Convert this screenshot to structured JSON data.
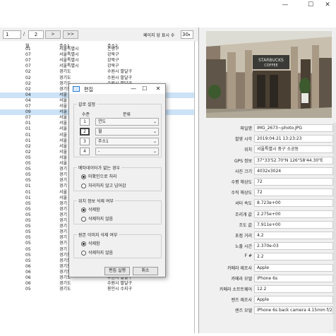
{
  "window": {
    "minimize_glyph": "—",
    "maximize_glyph": "☐",
    "close_glyph": "✕"
  },
  "toolbar": {
    "page_current": "1",
    "page_separator": "/",
    "page_total": "2",
    "next_label": ">",
    "last_label": ">>",
    "per_page_label": "페이지 당 표시 수",
    "per_page_value": "30"
  },
  "grid": {
    "headers": [
      "월",
      "주소1",
      "주소2"
    ],
    "rows": [
      {
        "month": "01",
        "addr1": "서울특별시",
        "addr2": "은평구",
        "selected": false
      },
      {
        "month": "07",
        "addr1": "서울특별시",
        "addr2": "강북구",
        "selected": false
      },
      {
        "month": "07",
        "addr1": "서울특별시",
        "addr2": "강북구",
        "selected": false
      },
      {
        "month": "07",
        "addr1": "서울특별시",
        "addr2": "강북구",
        "selected": false
      },
      {
        "month": "02",
        "addr1": "경기도",
        "addr2": "수원시 팔달구",
        "selected": false
      },
      {
        "month": "02",
        "addr1": "경기도",
        "addr2": "수원시 팔달구",
        "selected": false
      },
      {
        "month": "02",
        "addr1": "경기도",
        "addr2": "수원시 팔달구",
        "selected": false
      },
      {
        "month": "02",
        "addr1": "경기도",
        "addr2": "",
        "selected": false
      },
      {
        "month": "04",
        "addr1": "서울",
        "addr2": "",
        "selected": true
      },
      {
        "month": "04",
        "addr1": "서울",
        "addr2": "",
        "selected": false
      },
      {
        "month": "07",
        "addr1": "서울",
        "addr2": "",
        "selected": false
      },
      {
        "month": "09",
        "addr1": "서울",
        "addr2": "",
        "selected": true
      },
      {
        "month": "07",
        "addr1": "서울",
        "addr2": "",
        "selected": false
      },
      {
        "month": "01",
        "addr1": "서울",
        "addr2": "",
        "selected": false
      },
      {
        "month": "01",
        "addr1": "서울",
        "addr2": "",
        "selected": false
      },
      {
        "month": "01",
        "addr1": "서울",
        "addr2": "",
        "selected": false
      },
      {
        "month": "01",
        "addr1": "서울",
        "addr2": "",
        "selected": false
      },
      {
        "month": "02",
        "addr1": "서울",
        "addr2": "",
        "selected": false
      },
      {
        "month": "02",
        "addr1": "서울",
        "addr2": "",
        "selected": false
      },
      {
        "month": "05",
        "addr1": "서울",
        "addr2": "",
        "selected": false
      },
      {
        "month": "05",
        "addr1": "서울",
        "addr2": "",
        "selected": false
      },
      {
        "month": "05",
        "addr1": "경기",
        "addr2": "",
        "selected": false
      },
      {
        "month": "05",
        "addr1": "경기",
        "addr2": "",
        "selected": false
      },
      {
        "month": "05",
        "addr1": "경기",
        "addr2": "",
        "selected": false
      },
      {
        "month": "01",
        "addr1": "경기",
        "addr2": "",
        "selected": false
      },
      {
        "month": "01",
        "addr1": "서울",
        "addr2": "",
        "selected": false
      },
      {
        "month": "01",
        "addr1": "서울",
        "addr2": "",
        "selected": false
      },
      {
        "month": "05",
        "addr1": "경기",
        "addr2": "",
        "selected": false
      },
      {
        "month": "05",
        "addr1": "경기",
        "addr2": "",
        "selected": false
      },
      {
        "month": "05",
        "addr1": "경기",
        "addr2": "",
        "selected": false
      },
      {
        "month": "05",
        "addr1": "경기",
        "addr2": "",
        "selected": false
      },
      {
        "month": "05",
        "addr1": "경기",
        "addr2": "",
        "selected": false
      },
      {
        "month": "05",
        "addr1": "경기",
        "addr2": "",
        "selected": false
      },
      {
        "month": "05",
        "addr1": "경기",
        "addr2": "",
        "selected": false
      },
      {
        "month": "05",
        "addr1": "경기",
        "addr2": "",
        "selected": false
      },
      {
        "month": "05",
        "addr1": "경기",
        "addr2": "",
        "selected": false
      },
      {
        "month": "05",
        "addr1": "경기도",
        "addr2": "수원시 팔달구",
        "selected": false
      },
      {
        "month": "05",
        "addr1": "경기도",
        "addr2": "수원시 팔달구",
        "selected": false
      },
      {
        "month": "06",
        "addr1": "경기도",
        "addr2": "수원시 팔달구",
        "selected": false
      },
      {
        "month": "06",
        "addr1": "경기도",
        "addr2": "수원시 팔달구",
        "selected": false
      },
      {
        "month": "06",
        "addr1": "경기도",
        "addr2": "수원시 팔달구",
        "selected": false
      },
      {
        "month": "06",
        "addr1": "경기도",
        "addr2": "수원시 팔달구",
        "selected": false
      },
      {
        "month": "05",
        "addr1": "경기도",
        "addr2": "용인시 수지구",
        "selected": false
      }
    ]
  },
  "photo": {
    "sign_line1": "STARBUCKS",
    "sign_line2": "COFFEE"
  },
  "properties": [
    {
      "label": "파일명",
      "value": "IMG_2673~photo.JPG"
    },
    {
      "label": "촬영 시각",
      "value": "2019:04:21 13:23:23"
    },
    {
      "label": "위치",
      "value": "서울특별시 중구 소공동"
    },
    {
      "label": "GPS 정보",
      "value": "37°33'52.70\"N 126°58'44.30\"E"
    },
    {
      "label": "사진 크기",
      "value": "4032x3024"
    },
    {
      "label": "수평 해상도",
      "value": "72"
    },
    {
      "label": "수직 해상도",
      "value": "72"
    },
    {
      "label": "셔터 속도",
      "value": "8.723e+00"
    },
    {
      "label": "조리개 값",
      "value": "2.275e+00"
    },
    {
      "label": "조도 값",
      "value": "7.911e+00"
    },
    {
      "label": "초점 거리",
      "value": "4.2"
    },
    {
      "label": "노출 시간",
      "value": "2.370e-03"
    },
    {
      "label": "F #",
      "value": "2.2"
    },
    {
      "label": "카메라 제조사",
      "value": "Apple"
    },
    {
      "label": "카메라 모델",
      "value": "iPhone 6s"
    },
    {
      "label": "카메라 소프트웨어",
      "value": "12.2"
    },
    {
      "label": "렌즈 제조사",
      "value": "Apple"
    },
    {
      "label": "렌즈 모델",
      "value": "iPhone 6s back camera 4.15mm f/2.2"
    }
  ],
  "dialog": {
    "title": "편집",
    "minimize_glyph": "—",
    "maximize_glyph": "☐",
    "close_glyph": "✕",
    "class_group_label": "갈로 설정",
    "level_header": "수준",
    "category_header": "분류",
    "levels": [
      {
        "num": "1",
        "value": "연도",
        "active": false
      },
      {
        "num": "2",
        "value": "월",
        "active": true
      },
      {
        "num": "3",
        "value": "주소1",
        "active": false
      },
      {
        "num": "4",
        "value": "-",
        "active": false
      }
    ],
    "no_metadata_group": "메타데이터가 없는 경우",
    "no_metadata_options": [
      {
        "label": "미확인으로 처리",
        "checked": true
      },
      {
        "label": "처리하지 않고 넘어감",
        "checked": false
      }
    ],
    "delete_location_group": "위치 정보 삭제 여부",
    "delete_location_options": [
      {
        "label": "삭제함",
        "checked": true
      },
      {
        "label": "삭제하지 않음",
        "checked": false
      }
    ],
    "delete_original_group": "원본 이미지 삭제 여부",
    "delete_original_options": [
      {
        "label": "삭제함",
        "checked": true
      },
      {
        "label": "삭제하지 않음",
        "checked": false
      }
    ],
    "run_button": "편집 실행",
    "cancel_button": "취소"
  }
}
